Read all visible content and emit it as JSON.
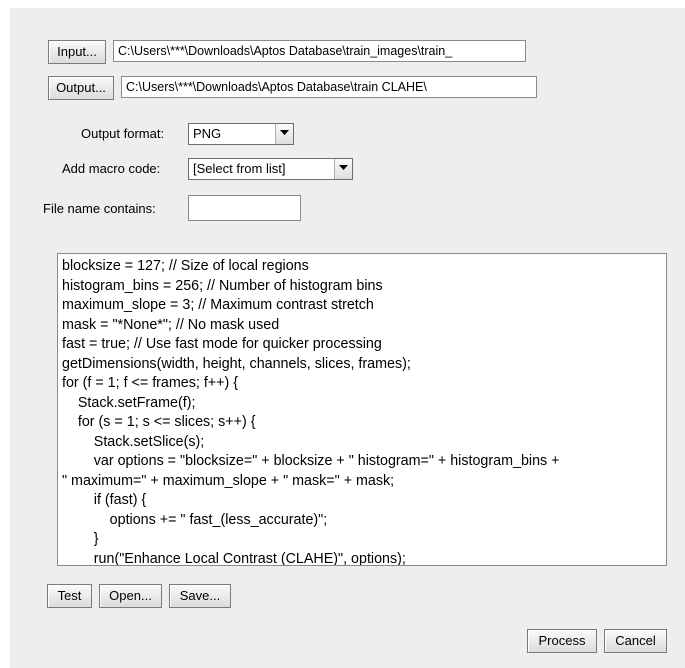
{
  "io": {
    "input_button": "Input...",
    "input_path": "C:\\Users\\***\\Downloads\\Aptos Database\\train_images\\train_",
    "output_button": "Output...",
    "output_path": "C:\\Users\\***\\Downloads\\Aptos Database\\train CLAHE\\"
  },
  "options": {
    "output_format_label": "Output format:",
    "output_format_value": "PNG",
    "macro_label": "Add macro code:",
    "macro_value": "[Select from list]",
    "filename_label": "File name contains:",
    "filename_value": ""
  },
  "code_lines": [
    "blocksize = 127; // Size of local regions",
    "histogram_bins = 256; // Number of histogram bins",
    "maximum_slope = 3; // Maximum contrast stretch",
    "mask = \"*None*\"; // No mask used",
    "fast = true; // Use fast mode for quicker processing",
    "getDimensions(width, height, channels, slices, frames);",
    "for (f = 1; f <= frames; f++) {",
    "    Stack.setFrame(f);",
    "    for (s = 1; s <= slices; s++) {",
    "        Stack.setSlice(s);",
    "        var options = \"blocksize=\" + blocksize + \" histogram=\" + histogram_bins +",
    "\" maximum=\" + maximum_slope + \" mask=\" + mask;",
    "        if (fast) {",
    "            options += \" fast_(less_accurate)\";",
    "        }",
    "        run(\"Enhance Local Contrast (CLAHE)\", options);"
  ],
  "actions": {
    "test": "Test",
    "open": "Open...",
    "save": "Save...",
    "process": "Process",
    "cancel": "Cancel"
  }
}
